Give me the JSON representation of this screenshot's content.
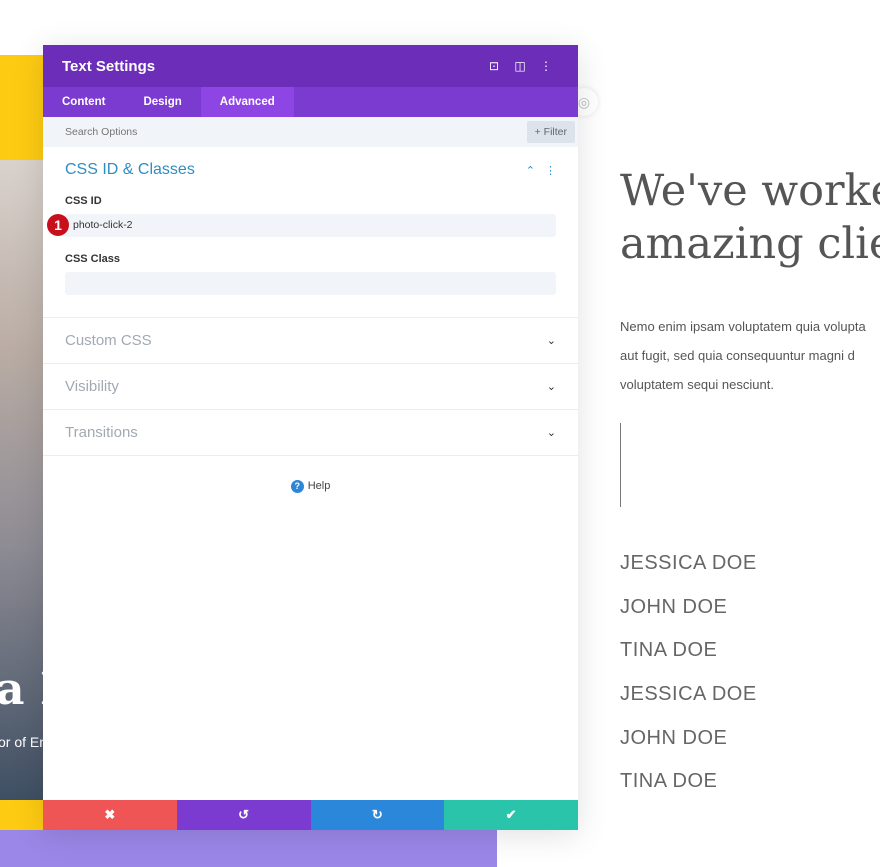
{
  "modal": {
    "title": "Text Settings",
    "tabs": [
      {
        "label": "Content"
      },
      {
        "label": "Design"
      },
      {
        "label": "Advanced"
      }
    ],
    "active_tab": "Advanced",
    "search_placeholder": "Search Options",
    "filter_label": "+ Filter",
    "section_open": {
      "title": "CSS ID & Classes",
      "css_id_label": "CSS ID",
      "css_id_value": "photo-click-2",
      "css_class_label": "CSS Class",
      "css_class_value": ""
    },
    "sections": [
      {
        "title": "Custom CSS"
      },
      {
        "title": "Visibility"
      },
      {
        "title": "Transitions"
      }
    ],
    "help_label": "Help",
    "step_badge": "1",
    "footer": {
      "cancel": "✖",
      "undo": "↺",
      "redo": "↻",
      "save": "✔"
    },
    "colors": {
      "header": "#6c2eb9",
      "tabs": "#7b3ad0",
      "active_tab": "#8d45e3",
      "cancel": "#ef5555",
      "undo": "#7c3bd0",
      "redo": "#2b87da",
      "save": "#29c4a9"
    }
  },
  "page": {
    "photo_title": "a I",
    "photo_subtitle": "or of En",
    "heading_line1": "We've worke",
    "heading_line2": "amazing clie",
    "paragraph": [
      "Nemo enim ipsam voluptatem quia volupta",
      "aut fugit, sed quia consequuntur magni d",
      "voluptatem sequi nesciunt."
    ],
    "names": [
      "JESSICA DOE",
      "JOHN DOE",
      "TINA DOE",
      "JESSICA DOE",
      "JOHN DOE",
      "TINA DOE"
    ]
  }
}
